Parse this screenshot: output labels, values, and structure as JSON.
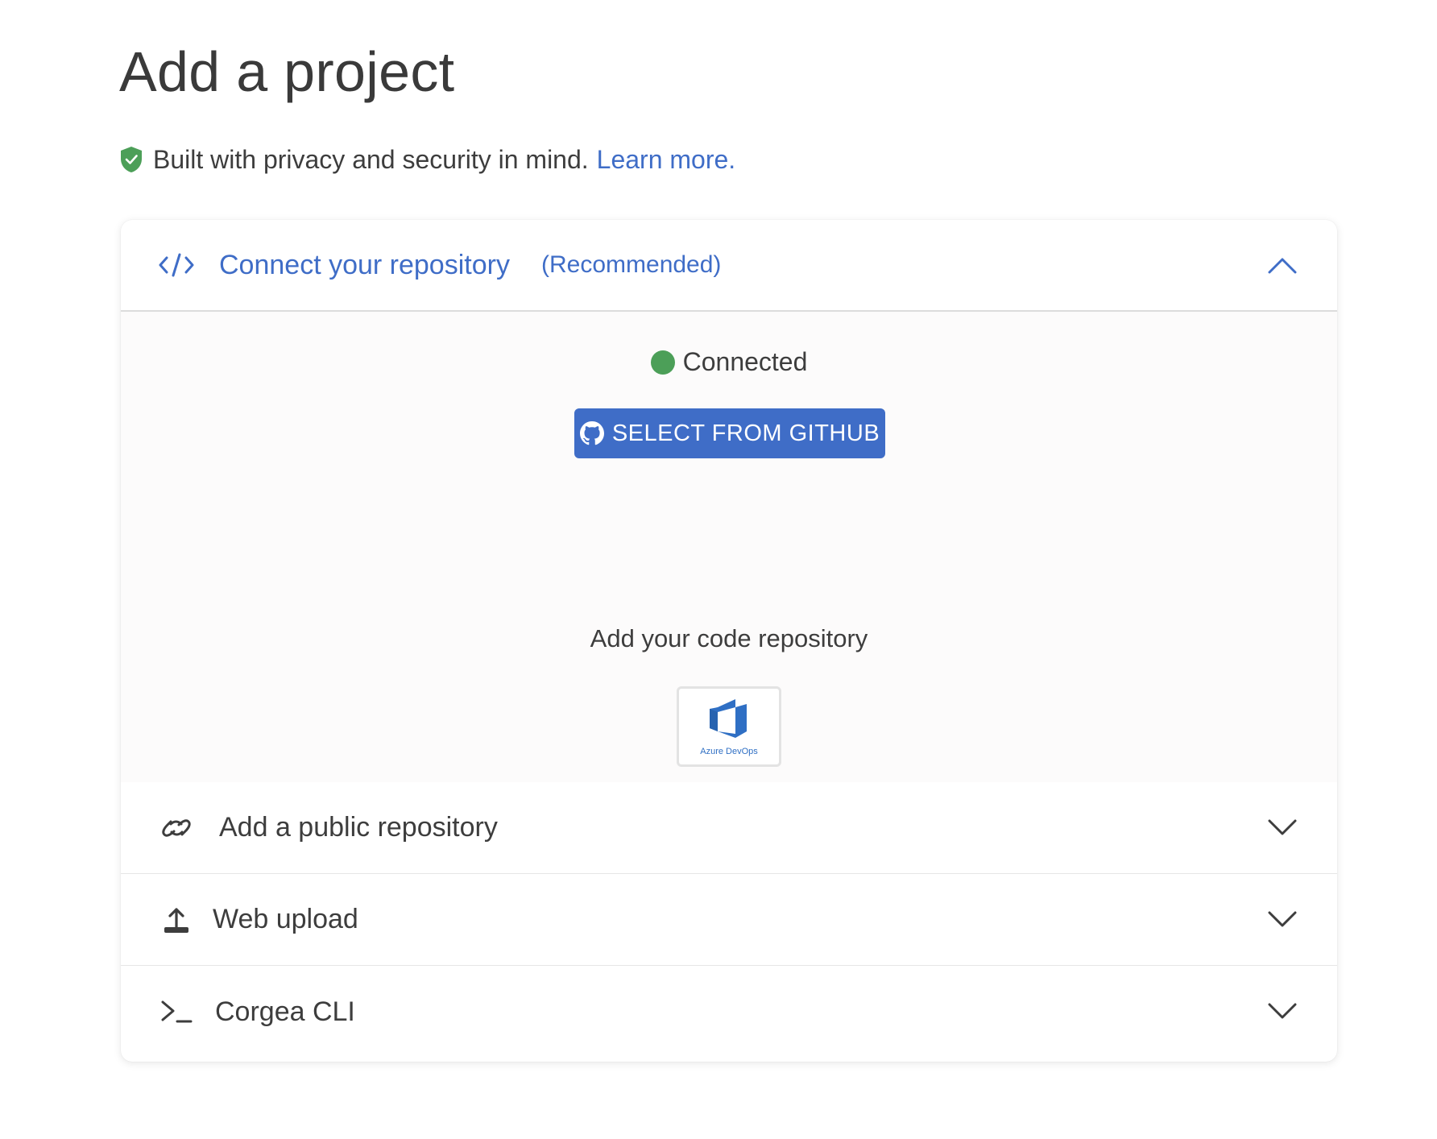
{
  "page": {
    "title": "Add a project"
  },
  "privacy": {
    "text": "Built with privacy and security in mind.",
    "link": "Learn more."
  },
  "sections": {
    "connect": {
      "title": "Connect your repository",
      "badge": "(Recommended)",
      "status": "Connected",
      "github_button": "SELECT FROM GITHUB",
      "add_code_label": "Add your code repository",
      "azure_label": "Azure DevOps"
    },
    "public_repo": {
      "title": "Add a public repository"
    },
    "web_upload": {
      "title": "Web upload"
    },
    "cli": {
      "title": "Corgea CLI"
    }
  },
  "colors": {
    "accent": "#3f6dc7",
    "status_green": "#4c9f58",
    "shield_green": "#4c9f58"
  },
  "icons": [
    "shield-check-icon",
    "code-icon",
    "chevron-up-icon",
    "github-icon",
    "azure-devops-icon",
    "link-icon",
    "upload-icon",
    "terminal-icon",
    "chevron-down-icon"
  ]
}
